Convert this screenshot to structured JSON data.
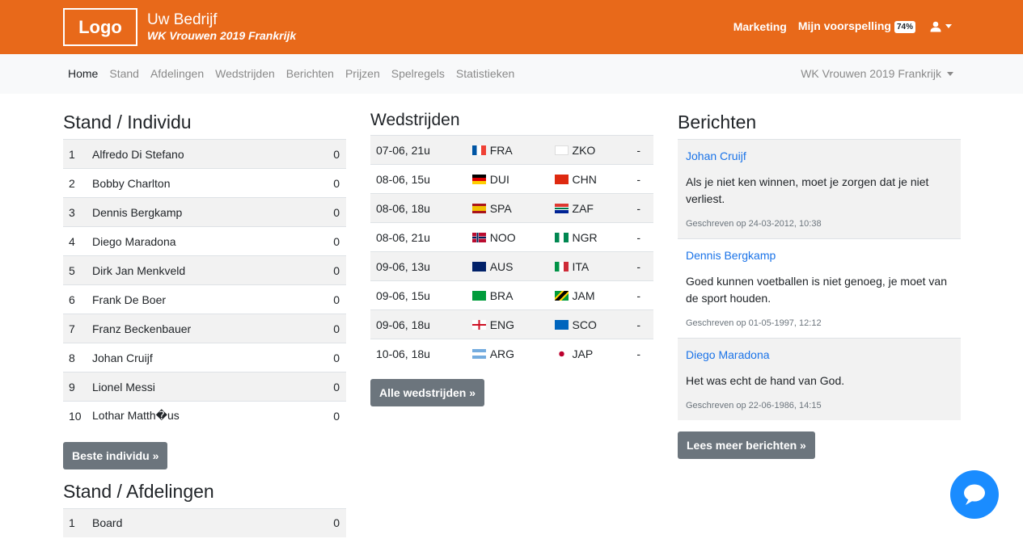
{
  "header": {
    "logo": "Logo",
    "company": "Uw Bedrijf",
    "tournament": "WK Vrouwen 2019 Frankrijk",
    "links": {
      "marketing": "Marketing",
      "predictions": "Mijn voorspelling",
      "predictions_pct": "74%"
    },
    "user_icon": "user-icon"
  },
  "nav": {
    "items": [
      "Home",
      "Stand",
      "Afdelingen",
      "Wedstrijden",
      "Berichten",
      "Prijzen",
      "Spelregels",
      "Statistieken"
    ],
    "active": "Home",
    "tournament_select": "WK Vrouwen 2019 Frankrijk"
  },
  "individual": {
    "title": "Stand / Individu",
    "rows": [
      {
        "rank": "1",
        "name": "Alfredo Di Stefano",
        "score": "0"
      },
      {
        "rank": "2",
        "name": "Bobby Charlton",
        "score": "0"
      },
      {
        "rank": "3",
        "name": "Dennis Bergkamp",
        "score": "0"
      },
      {
        "rank": "4",
        "name": "Diego Maradona",
        "score": "0"
      },
      {
        "rank": "5",
        "name": "Dirk Jan Menkveld",
        "score": "0"
      },
      {
        "rank": "6",
        "name": "Frank De Boer",
        "score": "0"
      },
      {
        "rank": "7",
        "name": "Franz Beckenbauer",
        "score": "0"
      },
      {
        "rank": "8",
        "name": "Johan Cruijf",
        "score": "0"
      },
      {
        "rank": "9",
        "name": "Lionel Messi",
        "score": "0"
      },
      {
        "rank": "10",
        "name": "Lothar Matth�us",
        "score": "0"
      }
    ],
    "button": "Beste individu »"
  },
  "departments": {
    "title": "Stand / Afdelingen",
    "rows": [
      {
        "rank": "1",
        "name": "Board",
        "score": "0"
      }
    ]
  },
  "matches": {
    "title": "Wedstrijden",
    "rows": [
      {
        "date": "07-06, 21u",
        "home": "FRA",
        "away": "ZKO",
        "result": "-"
      },
      {
        "date": "08-06, 15u",
        "home": "DUI",
        "away": "CHN",
        "result": "-"
      },
      {
        "date": "08-06, 18u",
        "home": "SPA",
        "away": "ZAF",
        "result": "-"
      },
      {
        "date": "08-06, 21u",
        "home": "NOO",
        "away": "NGR",
        "result": "-"
      },
      {
        "date": "09-06, 13u",
        "home": "AUS",
        "away": "ITA",
        "result": "-"
      },
      {
        "date": "09-06, 15u",
        "home": "BRA",
        "away": "JAM",
        "result": "-"
      },
      {
        "date": "09-06, 18u",
        "home": "ENG",
        "away": "SCO",
        "result": "-"
      },
      {
        "date": "10-06, 18u",
        "home": "ARG",
        "away": "JAP",
        "result": "-"
      }
    ],
    "button": "Alle wedstrijden »"
  },
  "messages": {
    "title": "Berichten",
    "items": [
      {
        "author": "Johan Cruijf",
        "text": "Als je niet ken winnen, moet je zorgen dat je niet verliest.",
        "date": "Geschreven op 24-03-2012, 10:38"
      },
      {
        "author": "Dennis Bergkamp",
        "text": "Goed kunnen voetballen is niet genoeg, je moet van de sport houden.",
        "date": "Geschreven op 01-05-1997, 12:12"
      },
      {
        "author": "Diego Maradona",
        "text": "Het was echt de hand van God.",
        "date": "Geschreven op 22-06-1986, 14:15"
      }
    ],
    "button": "Lees meer berichten »"
  },
  "colors": {
    "brand": "#e8691a",
    "link": "#1a73e8",
    "button": "#6c757d",
    "chat": "#1a8cff"
  },
  "chat_icon": "chat-bubble-icon"
}
